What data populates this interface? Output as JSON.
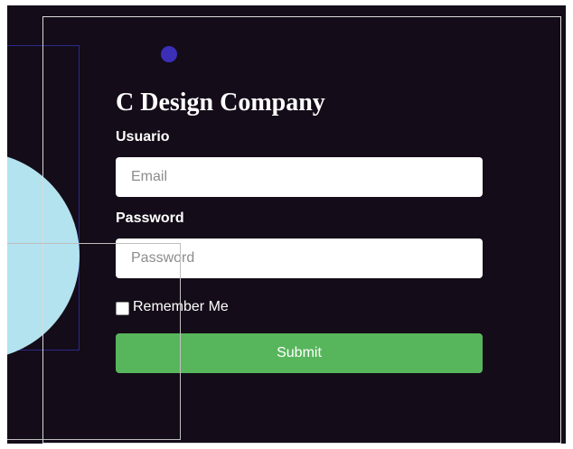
{
  "brand": {
    "title": "C Design Company"
  },
  "form": {
    "username_label": "Usuario",
    "email_placeholder": "Email",
    "email_value": "",
    "password_label": "Password",
    "password_placeholder": "Password",
    "password_value": "",
    "remember_label": "Remember Me",
    "remember_checked": false,
    "submit_label": "Submit"
  },
  "colors": {
    "background": "#140c18",
    "accent_circle": "#b3e3ef",
    "dot": "#3b2fb8",
    "submit": "#57b65c",
    "frame": "#d9d9d9"
  }
}
